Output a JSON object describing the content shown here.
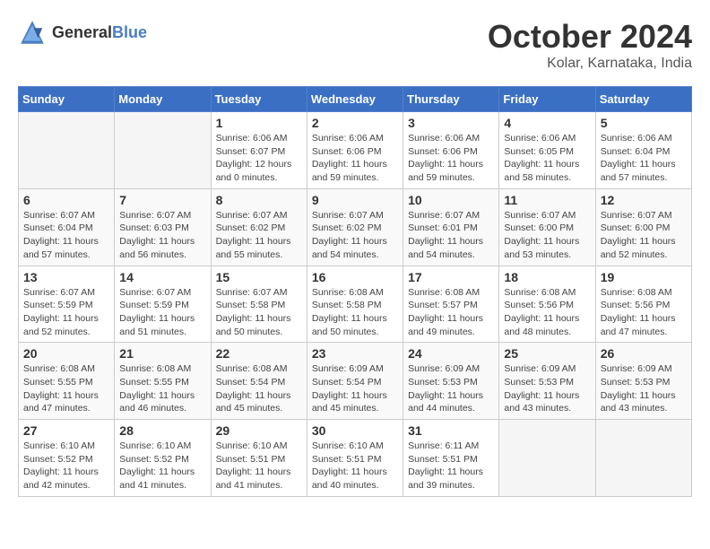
{
  "logo": {
    "general": "General",
    "blue": "Blue"
  },
  "title": {
    "month": "October 2024",
    "location": "Kolar, Karnataka, India"
  },
  "headers": [
    "Sunday",
    "Monday",
    "Tuesday",
    "Wednesday",
    "Thursday",
    "Friday",
    "Saturday"
  ],
  "weeks": [
    [
      {
        "day": "",
        "info": ""
      },
      {
        "day": "",
        "info": ""
      },
      {
        "day": "1",
        "info": "Sunrise: 6:06 AM\nSunset: 6:07 PM\nDaylight: 12 hours\nand 0 minutes."
      },
      {
        "day": "2",
        "info": "Sunrise: 6:06 AM\nSunset: 6:06 PM\nDaylight: 11 hours\nand 59 minutes."
      },
      {
        "day": "3",
        "info": "Sunrise: 6:06 AM\nSunset: 6:06 PM\nDaylight: 11 hours\nand 59 minutes."
      },
      {
        "day": "4",
        "info": "Sunrise: 6:06 AM\nSunset: 6:05 PM\nDaylight: 11 hours\nand 58 minutes."
      },
      {
        "day": "5",
        "info": "Sunrise: 6:06 AM\nSunset: 6:04 PM\nDaylight: 11 hours\nand 57 minutes."
      }
    ],
    [
      {
        "day": "6",
        "info": "Sunrise: 6:07 AM\nSunset: 6:04 PM\nDaylight: 11 hours\nand 57 minutes."
      },
      {
        "day": "7",
        "info": "Sunrise: 6:07 AM\nSunset: 6:03 PM\nDaylight: 11 hours\nand 56 minutes."
      },
      {
        "day": "8",
        "info": "Sunrise: 6:07 AM\nSunset: 6:02 PM\nDaylight: 11 hours\nand 55 minutes."
      },
      {
        "day": "9",
        "info": "Sunrise: 6:07 AM\nSunset: 6:02 PM\nDaylight: 11 hours\nand 54 minutes."
      },
      {
        "day": "10",
        "info": "Sunrise: 6:07 AM\nSunset: 6:01 PM\nDaylight: 11 hours\nand 54 minutes."
      },
      {
        "day": "11",
        "info": "Sunrise: 6:07 AM\nSunset: 6:00 PM\nDaylight: 11 hours\nand 53 minutes."
      },
      {
        "day": "12",
        "info": "Sunrise: 6:07 AM\nSunset: 6:00 PM\nDaylight: 11 hours\nand 52 minutes."
      }
    ],
    [
      {
        "day": "13",
        "info": "Sunrise: 6:07 AM\nSunset: 5:59 PM\nDaylight: 11 hours\nand 52 minutes."
      },
      {
        "day": "14",
        "info": "Sunrise: 6:07 AM\nSunset: 5:59 PM\nDaylight: 11 hours\nand 51 minutes."
      },
      {
        "day": "15",
        "info": "Sunrise: 6:07 AM\nSunset: 5:58 PM\nDaylight: 11 hours\nand 50 minutes."
      },
      {
        "day": "16",
        "info": "Sunrise: 6:08 AM\nSunset: 5:58 PM\nDaylight: 11 hours\nand 50 minutes."
      },
      {
        "day": "17",
        "info": "Sunrise: 6:08 AM\nSunset: 5:57 PM\nDaylight: 11 hours\nand 49 minutes."
      },
      {
        "day": "18",
        "info": "Sunrise: 6:08 AM\nSunset: 5:56 PM\nDaylight: 11 hours\nand 48 minutes."
      },
      {
        "day": "19",
        "info": "Sunrise: 6:08 AM\nSunset: 5:56 PM\nDaylight: 11 hours\nand 47 minutes."
      }
    ],
    [
      {
        "day": "20",
        "info": "Sunrise: 6:08 AM\nSunset: 5:55 PM\nDaylight: 11 hours\nand 47 minutes."
      },
      {
        "day": "21",
        "info": "Sunrise: 6:08 AM\nSunset: 5:55 PM\nDaylight: 11 hours\nand 46 minutes."
      },
      {
        "day": "22",
        "info": "Sunrise: 6:08 AM\nSunset: 5:54 PM\nDaylight: 11 hours\nand 45 minutes."
      },
      {
        "day": "23",
        "info": "Sunrise: 6:09 AM\nSunset: 5:54 PM\nDaylight: 11 hours\nand 45 minutes."
      },
      {
        "day": "24",
        "info": "Sunrise: 6:09 AM\nSunset: 5:53 PM\nDaylight: 11 hours\nand 44 minutes."
      },
      {
        "day": "25",
        "info": "Sunrise: 6:09 AM\nSunset: 5:53 PM\nDaylight: 11 hours\nand 43 minutes."
      },
      {
        "day": "26",
        "info": "Sunrise: 6:09 AM\nSunset: 5:53 PM\nDaylight: 11 hours\nand 43 minutes."
      }
    ],
    [
      {
        "day": "27",
        "info": "Sunrise: 6:10 AM\nSunset: 5:52 PM\nDaylight: 11 hours\nand 42 minutes."
      },
      {
        "day": "28",
        "info": "Sunrise: 6:10 AM\nSunset: 5:52 PM\nDaylight: 11 hours\nand 41 minutes."
      },
      {
        "day": "29",
        "info": "Sunrise: 6:10 AM\nSunset: 5:51 PM\nDaylight: 11 hours\nand 41 minutes."
      },
      {
        "day": "30",
        "info": "Sunrise: 6:10 AM\nSunset: 5:51 PM\nDaylight: 11 hours\nand 40 minutes."
      },
      {
        "day": "31",
        "info": "Sunrise: 6:11 AM\nSunset: 5:51 PM\nDaylight: 11 hours\nand 39 minutes."
      },
      {
        "day": "",
        "info": ""
      },
      {
        "day": "",
        "info": ""
      }
    ]
  ]
}
